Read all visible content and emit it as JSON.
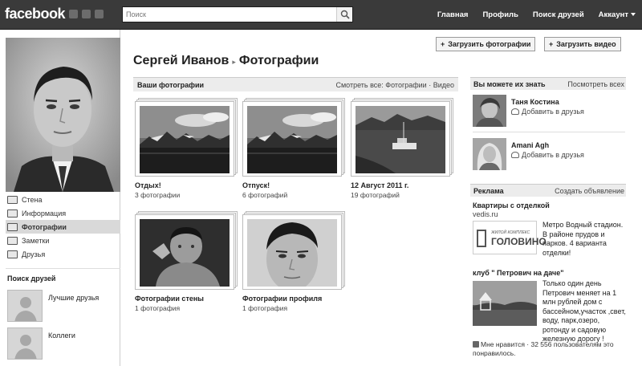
{
  "topbar": {
    "logo": "facebook",
    "search_placeholder": "Поиск",
    "nav": [
      "Главная",
      "Профиль",
      "Поиск друзей",
      "Аккаунт"
    ]
  },
  "left": {
    "menu": [
      {
        "label": "Стена",
        "icon": "wall-icon"
      },
      {
        "label": "Информация",
        "icon": "info-icon"
      },
      {
        "label": "Фотографии",
        "icon": "photos-icon",
        "active": true
      },
      {
        "label": "Заметки",
        "icon": "notes-icon"
      },
      {
        "label": "Друзья",
        "icon": "friends-icon"
      }
    ],
    "find_title": "Поиск друзей",
    "find_rows": [
      "Лучшие друзья",
      "Коллеги"
    ]
  },
  "main": {
    "upload_photos": "Загрузить фотографии",
    "upload_video": "Загрузить видео",
    "title_user": "Сергей Иванов",
    "title_section": "Фотографии",
    "section_title": "Ваши фотографии",
    "section_links": "Смотреть все: Фотографии · Видео",
    "albums": [
      {
        "name": "Отдых!",
        "count": "3 фотографии"
      },
      {
        "name": "Отпуск!",
        "count": "6 фотографий"
      },
      {
        "name": "12 Август 2011 г.",
        "count": "19 фотографий"
      },
      {
        "name": "Фотографии стены",
        "count": "1 фотография"
      },
      {
        "name": "Фотографии профиля",
        "count": "1 фотография"
      }
    ]
  },
  "right": {
    "pymk_title": "Вы можете их знать",
    "pymk_link": "Посмотреть всех",
    "people": [
      {
        "name": "Таня Костина",
        "action": "Добавить в друзья"
      },
      {
        "name": "Amani Agh",
        "action": "Добавить в друзья"
      }
    ],
    "ads_title": "Реклама",
    "ads_link": "Создать объявление",
    "ad1": {
      "title": "Квартиры с отделкой",
      "url": "vedis.ru",
      "text": "Метро Водный стадион. В районе прудов и парков. 4 варианта отделки!",
      "logo_small": "ЖИЛОЙ КОМПЛЕКС",
      "logo_big": "ГОЛОВИНО"
    },
    "ad2": {
      "title": "клуб \" Петрович на даче\"",
      "text": "Только один день Петрович меняет на 1 млн рублей дом с бассейном,участок ,свет, воду, парк,озеро, ротонду и садовую железную дорогу !",
      "likes": "Мне нравится · 32 556 пользователям это понравилось."
    }
  }
}
